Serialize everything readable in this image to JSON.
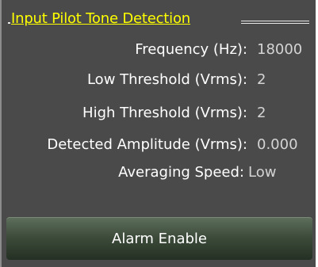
{
  "group": {
    "title": "Input Pilot Tone Detection"
  },
  "rows": [
    {
      "label": "Frequency (Hz):",
      "value": "18000"
    },
    {
      "label": "Low  Threshold (Vrms):",
      "value": "2"
    },
    {
      "label": "High Threshold (Vrms):",
      "value": "2"
    },
    {
      "label": "Detected Amplitude (Vrms):",
      "value": "0.000"
    },
    {
      "label": "Averaging Speed:",
      "value": "Low"
    }
  ],
  "alarm_button": {
    "label": "Alarm Enable"
  },
  "colors": {
    "panel_background": "#4a4a4a",
    "title": "#ffff00",
    "label": "#ffffff",
    "value": "#d4d4d4"
  }
}
